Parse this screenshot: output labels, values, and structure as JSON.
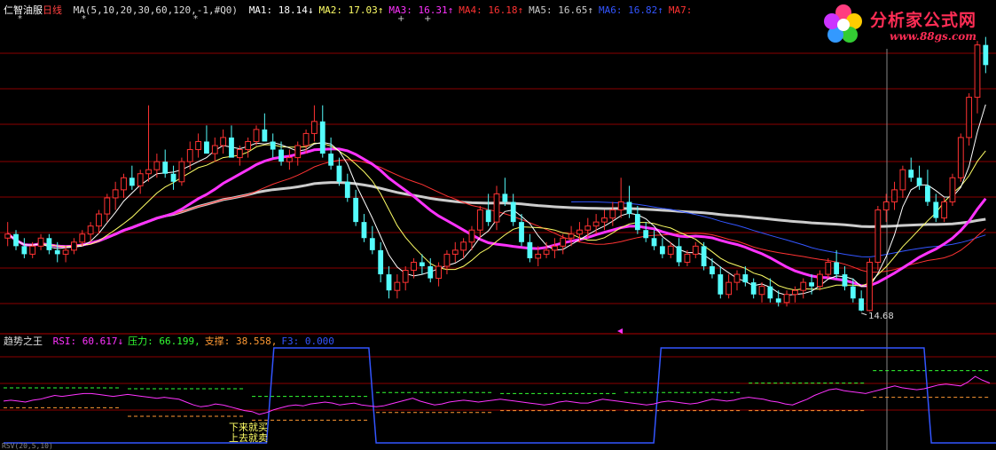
{
  "header": {
    "name": "仁智油服",
    "period": "日线",
    "ma_params": "MA(5,10,20,30,60,120,-1,#Q0)",
    "items": [
      {
        "label": "MA1:",
        "value": "18.14",
        "arrow": "↓",
        "color": "#ffffff"
      },
      {
        "label": "MA2:",
        "value": "17.03",
        "arrow": "↑",
        "color": "#ffff66"
      },
      {
        "label": "MA3:",
        "value": "16.31",
        "arrow": "↑",
        "color": "#ff33ff"
      },
      {
        "label": "MA4:",
        "value": "16.18",
        "arrow": "↑",
        "color": "#ff3333"
      },
      {
        "label": "MA5:",
        "value": "16.65",
        "arrow": "↑",
        "color": "#cccccc"
      },
      {
        "label": "MA6:",
        "value": "16.82",
        "arrow": "↑",
        "color": "#3355ff"
      },
      {
        "label": "MA7:",
        "value": "",
        "arrow": "",
        "color": "#ff3333"
      }
    ]
  },
  "indicator_header": {
    "name": "趋势之王",
    "items": [
      {
        "label": "RSI:",
        "value": "60.617",
        "arrow": "↓",
        "color": "#ff33ff"
      },
      {
        "label": "压力:",
        "value": "66.199,",
        "arrow": "",
        "color": "#33ff33"
      },
      {
        "label": "支撑:",
        "value": "38.558,",
        "arrow": "",
        "color": "#ff9933"
      },
      {
        "label": "F3:",
        "value": "0.000",
        "arrow": "",
        "color": "#3355ff"
      }
    ]
  },
  "logo": {
    "title": "分析家公式网",
    "url": "www.88gs.com"
  },
  "annotations": {
    "low_price": "14.68",
    "note_line1": "下来就买",
    "note_line2": "上去就卖"
  },
  "bottom_label": "RSV(20,5,10)",
  "colors": {
    "up": "#ff3232",
    "down": "#54fcfc",
    "ma1": "#ffffff",
    "ma2": "#ffff66",
    "ma3": "#ff33ff",
    "ma4": "#ff3333",
    "ma5": "#cccccc",
    "ma6": "#3355ff",
    "grid": "#8b0000",
    "rsi": "#ff33ff",
    "pressure": "#33ff33",
    "support": "#ff9933",
    "f3": "#3355ff"
  },
  "chart_data": [
    {
      "type": "candlestick",
      "ylim": [
        14.3,
        21.8
      ],
      "candles": [
        [
          16.5,
          16.9,
          16.3,
          16.6
        ],
        [
          16.6,
          16.7,
          16.2,
          16.3
        ],
        [
          16.3,
          16.5,
          16.0,
          16.1
        ],
        [
          16.1,
          16.4,
          16.0,
          16.3
        ],
        [
          16.3,
          16.6,
          16.2,
          16.5
        ],
        [
          16.5,
          16.6,
          16.1,
          16.2
        ],
        [
          16.2,
          16.4,
          15.9,
          16.1
        ],
        [
          16.1,
          16.3,
          15.9,
          16.2
        ],
        [
          16.2,
          16.5,
          16.1,
          16.4
        ],
        [
          16.4,
          16.7,
          16.3,
          16.6
        ],
        [
          16.6,
          16.9,
          16.4,
          16.8
        ],
        [
          16.8,
          17.2,
          16.6,
          17.1
        ],
        [
          17.1,
          17.6,
          16.9,
          17.5
        ],
        [
          17.5,
          17.9,
          17.2,
          17.7
        ],
        [
          17.7,
          18.1,
          17.5,
          18.0
        ],
        [
          18.0,
          18.3,
          17.7,
          17.8
        ],
        [
          17.8,
          18.2,
          17.6,
          18.1
        ],
        [
          18.1,
          19.8,
          17.9,
          18.2
        ],
        [
          18.2,
          18.6,
          18.0,
          18.4
        ],
        [
          18.4,
          18.7,
          18.0,
          18.1
        ],
        [
          18.1,
          18.3,
          17.7,
          17.9
        ],
        [
          17.9,
          18.5,
          17.8,
          18.4
        ],
        [
          18.4,
          18.9,
          18.2,
          18.7
        ],
        [
          18.7,
          19.1,
          18.5,
          18.9
        ],
        [
          18.9,
          19.3,
          18.7,
          18.6
        ],
        [
          18.6,
          19.0,
          18.4,
          18.8
        ],
        [
          18.8,
          19.2,
          18.6,
          19.0
        ],
        [
          19.0,
          19.3,
          18.7,
          18.5
        ],
        [
          18.5,
          18.8,
          18.3,
          18.7
        ],
        [
          18.7,
          19.0,
          18.5,
          18.9
        ],
        [
          18.9,
          19.3,
          18.8,
          19.2
        ],
        [
          19.2,
          19.6,
          19.0,
          18.9
        ],
        [
          18.9,
          19.1,
          18.5,
          18.7
        ],
        [
          18.7,
          18.9,
          18.3,
          18.4
        ],
        [
          18.4,
          18.7,
          18.2,
          18.5
        ],
        [
          18.5,
          18.9,
          18.3,
          18.8
        ],
        [
          18.8,
          19.2,
          18.6,
          19.1
        ],
        [
          19.1,
          19.8,
          18.9,
          19.4
        ],
        [
          19.4,
          19.8,
          18.5,
          18.6
        ],
        [
          18.6,
          19.0,
          18.2,
          18.3
        ],
        [
          18.3,
          18.5,
          17.8,
          17.9
        ],
        [
          17.9,
          18.1,
          17.4,
          17.5
        ],
        [
          17.5,
          17.7,
          16.8,
          16.9
        ],
        [
          16.9,
          17.1,
          16.4,
          16.5
        ],
        [
          16.5,
          16.8,
          16.1,
          16.2
        ],
        [
          16.2,
          16.4,
          15.4,
          15.6
        ],
        [
          15.6,
          15.8,
          15.0,
          15.2
        ],
        [
          15.2,
          15.6,
          15.0,
          15.4
        ],
        [
          15.4,
          15.8,
          15.2,
          15.7
        ],
        [
          15.7,
          16.0,
          15.5,
          15.9
        ],
        [
          15.9,
          16.1,
          15.6,
          15.8
        ],
        [
          15.8,
          16.0,
          15.4,
          15.5
        ],
        [
          15.5,
          15.9,
          15.3,
          15.8
        ],
        [
          15.8,
          16.2,
          15.6,
          16.1
        ],
        [
          16.1,
          16.4,
          15.9,
          16.2
        ],
        [
          16.2,
          16.5,
          16.0,
          16.4
        ],
        [
          16.4,
          16.8,
          16.2,
          16.7
        ],
        [
          16.7,
          17.3,
          16.5,
          17.2
        ],
        [
          17.2,
          17.6,
          16.8,
          16.9
        ],
        [
          16.9,
          17.8,
          16.7,
          17.6
        ],
        [
          17.6,
          18.0,
          17.3,
          17.4
        ],
        [
          17.4,
          17.6,
          16.8,
          16.9
        ],
        [
          16.9,
          17.1,
          16.3,
          16.4
        ],
        [
          16.4,
          16.6,
          15.9,
          16.0
        ],
        [
          16.0,
          16.3,
          15.8,
          16.1
        ],
        [
          16.1,
          16.4,
          16.0,
          16.2
        ],
        [
          16.2,
          16.5,
          16.0,
          16.3
        ],
        [
          16.3,
          16.6,
          16.1,
          16.5
        ],
        [
          16.5,
          16.8,
          16.3,
          16.6
        ],
        [
          16.6,
          16.9,
          16.4,
          16.7
        ],
        [
          16.7,
          17.0,
          16.5,
          16.8
        ],
        [
          16.8,
          17.1,
          16.6,
          16.9
        ],
        [
          16.9,
          17.2,
          16.7,
          17.0
        ],
        [
          17.0,
          17.4,
          16.8,
          17.2
        ],
        [
          17.2,
          18.0,
          17.0,
          17.4
        ],
        [
          17.4,
          17.8,
          17.0,
          17.1
        ],
        [
          17.1,
          17.3,
          16.6,
          16.7
        ],
        [
          16.7,
          16.9,
          16.4,
          16.5
        ],
        [
          16.5,
          16.7,
          16.2,
          16.3
        ],
        [
          16.3,
          16.5,
          16.0,
          16.1
        ],
        [
          16.1,
          16.4,
          16.0,
          16.3
        ],
        [
          16.3,
          16.5,
          15.8,
          15.9
        ],
        [
          15.9,
          16.2,
          15.8,
          16.1
        ],
        [
          16.1,
          16.4,
          16.0,
          16.3
        ],
        [
          16.3,
          16.4,
          15.7,
          15.8
        ],
        [
          15.8,
          16.0,
          15.5,
          15.6
        ],
        [
          15.6,
          15.8,
          15.0,
          15.1
        ],
        [
          15.1,
          15.6,
          15.0,
          15.4
        ],
        [
          15.4,
          15.7,
          15.2,
          15.6
        ],
        [
          15.6,
          15.8,
          15.3,
          15.4
        ],
        [
          15.4,
          15.5,
          15.0,
          15.1
        ],
        [
          15.1,
          15.4,
          14.9,
          15.3
        ],
        [
          15.3,
          15.5,
          14.9,
          15.0
        ],
        [
          15.0,
          15.2,
          14.8,
          14.9
        ],
        [
          14.9,
          15.2,
          14.8,
          15.1
        ],
        [
          15.1,
          15.3,
          14.9,
          15.2
        ],
        [
          15.2,
          15.5,
          15.0,
          15.4
        ],
        [
          15.4,
          15.6,
          15.1,
          15.3
        ],
        [
          15.3,
          15.7,
          15.2,
          15.6
        ],
        [
          15.6,
          16.0,
          15.5,
          15.9
        ],
        [
          15.9,
          16.2,
          15.5,
          15.6
        ],
        [
          15.6,
          15.8,
          15.2,
          15.3
        ],
        [
          15.3,
          15.5,
          14.9,
          15.0
        ],
        [
          15.0,
          15.2,
          14.68,
          14.7
        ],
        [
          14.7,
          16.0,
          14.68,
          15.9
        ],
        [
          15.9,
          17.3,
          15.7,
          17.2
        ],
        [
          17.2,
          17.6,
          16.9,
          17.4
        ],
        [
          17.4,
          17.9,
          17.2,
          17.7
        ],
        [
          17.7,
          18.3,
          17.5,
          18.2
        ],
        [
          18.2,
          18.5,
          17.9,
          18.0
        ],
        [
          18.0,
          18.3,
          17.7,
          17.8
        ],
        [
          17.8,
          18.2,
          17.3,
          17.4
        ],
        [
          17.4,
          17.6,
          16.9,
          17.0
        ],
        [
          17.0,
          17.5,
          16.9,
          17.4
        ],
        [
          17.4,
          18.1,
          17.3,
          18.0
        ],
        [
          18.0,
          19.1,
          17.9,
          19.0
        ],
        [
          19.0,
          20.1,
          18.8,
          20.0
        ],
        [
          20.0,
          21.4,
          19.6,
          21.3
        ],
        [
          21.3,
          21.5,
          20.6,
          20.8
        ]
      ]
    },
    {
      "type": "line",
      "ylim": [
        0,
        100
      ],
      "series": [
        {
          "name": "RSI",
          "values": [
            44,
            45,
            44,
            43,
            45,
            46,
            48,
            50,
            49,
            50,
            51,
            52,
            52,
            51,
            50,
            49,
            50,
            51,
            50,
            49,
            48,
            47,
            48,
            47,
            46,
            43,
            40,
            38,
            39,
            41,
            40,
            38,
            36,
            34,
            33,
            30,
            32,
            35,
            37,
            39,
            40,
            39,
            41,
            42,
            43,
            42,
            40,
            41,
            42,
            40,
            39,
            38,
            39,
            41,
            43,
            45,
            47,
            44,
            42,
            40,
            41,
            43,
            44,
            45,
            44,
            43,
            44,
            45,
            46,
            45,
            44,
            43,
            42,
            41,
            40,
            41,
            43,
            44,
            43,
            42,
            42,
            44,
            46,
            45,
            44,
            43,
            42,
            41,
            40,
            41,
            43,
            44,
            43,
            42,
            41,
            42,
            44,
            46,
            45,
            44,
            45,
            47,
            48,
            47,
            46,
            44,
            43,
            41,
            40,
            43,
            46,
            50,
            53,
            56,
            57,
            55,
            54,
            53,
            52,
            54,
            56,
            58,
            60,
            58,
            57,
            56,
            57,
            59,
            61,
            62,
            61,
            60,
            64,
            70,
            66,
            63
          ]
        },
        {
          "name": "F3",
          "values": [
            0,
            0,
            0,
            0,
            0,
            0,
            0,
            0,
            0,
            0,
            0,
            0,
            0,
            0,
            0,
            0,
            0,
            0,
            0,
            0,
            0,
            0,
            0,
            0,
            0,
            0,
            0,
            0,
            0,
            0,
            0,
            0,
            0,
            0,
            0,
            0,
            0,
            100,
            100,
            100,
            100,
            100,
            100,
            100,
            100,
            100,
            100,
            100,
            100,
            100,
            100,
            0,
            0,
            0,
            0,
            0,
            0,
            0,
            0,
            0,
            0,
            0,
            0,
            0,
            0,
            0,
            0,
            0,
            0,
            0,
            0,
            0,
            0,
            0,
            0,
            0,
            0,
            0,
            0,
            0,
            0,
            0,
            0,
            0,
            0,
            0,
            0,
            0,
            0,
            0,
            100,
            100,
            100,
            100,
            100,
            100,
            100,
            100,
            100,
            100,
            100,
            100,
            100,
            100,
            100,
            100,
            100,
            100,
            100,
            100,
            100,
            100,
            100,
            100,
            100,
            100,
            100,
            100,
            100,
            100,
            100,
            100,
            100,
            100,
            100,
            100,
            100,
            0,
            0,
            0,
            0,
            0,
            0,
            0,
            0,
            0,
            0,
            0,
            100
          ]
        }
      ]
    }
  ]
}
